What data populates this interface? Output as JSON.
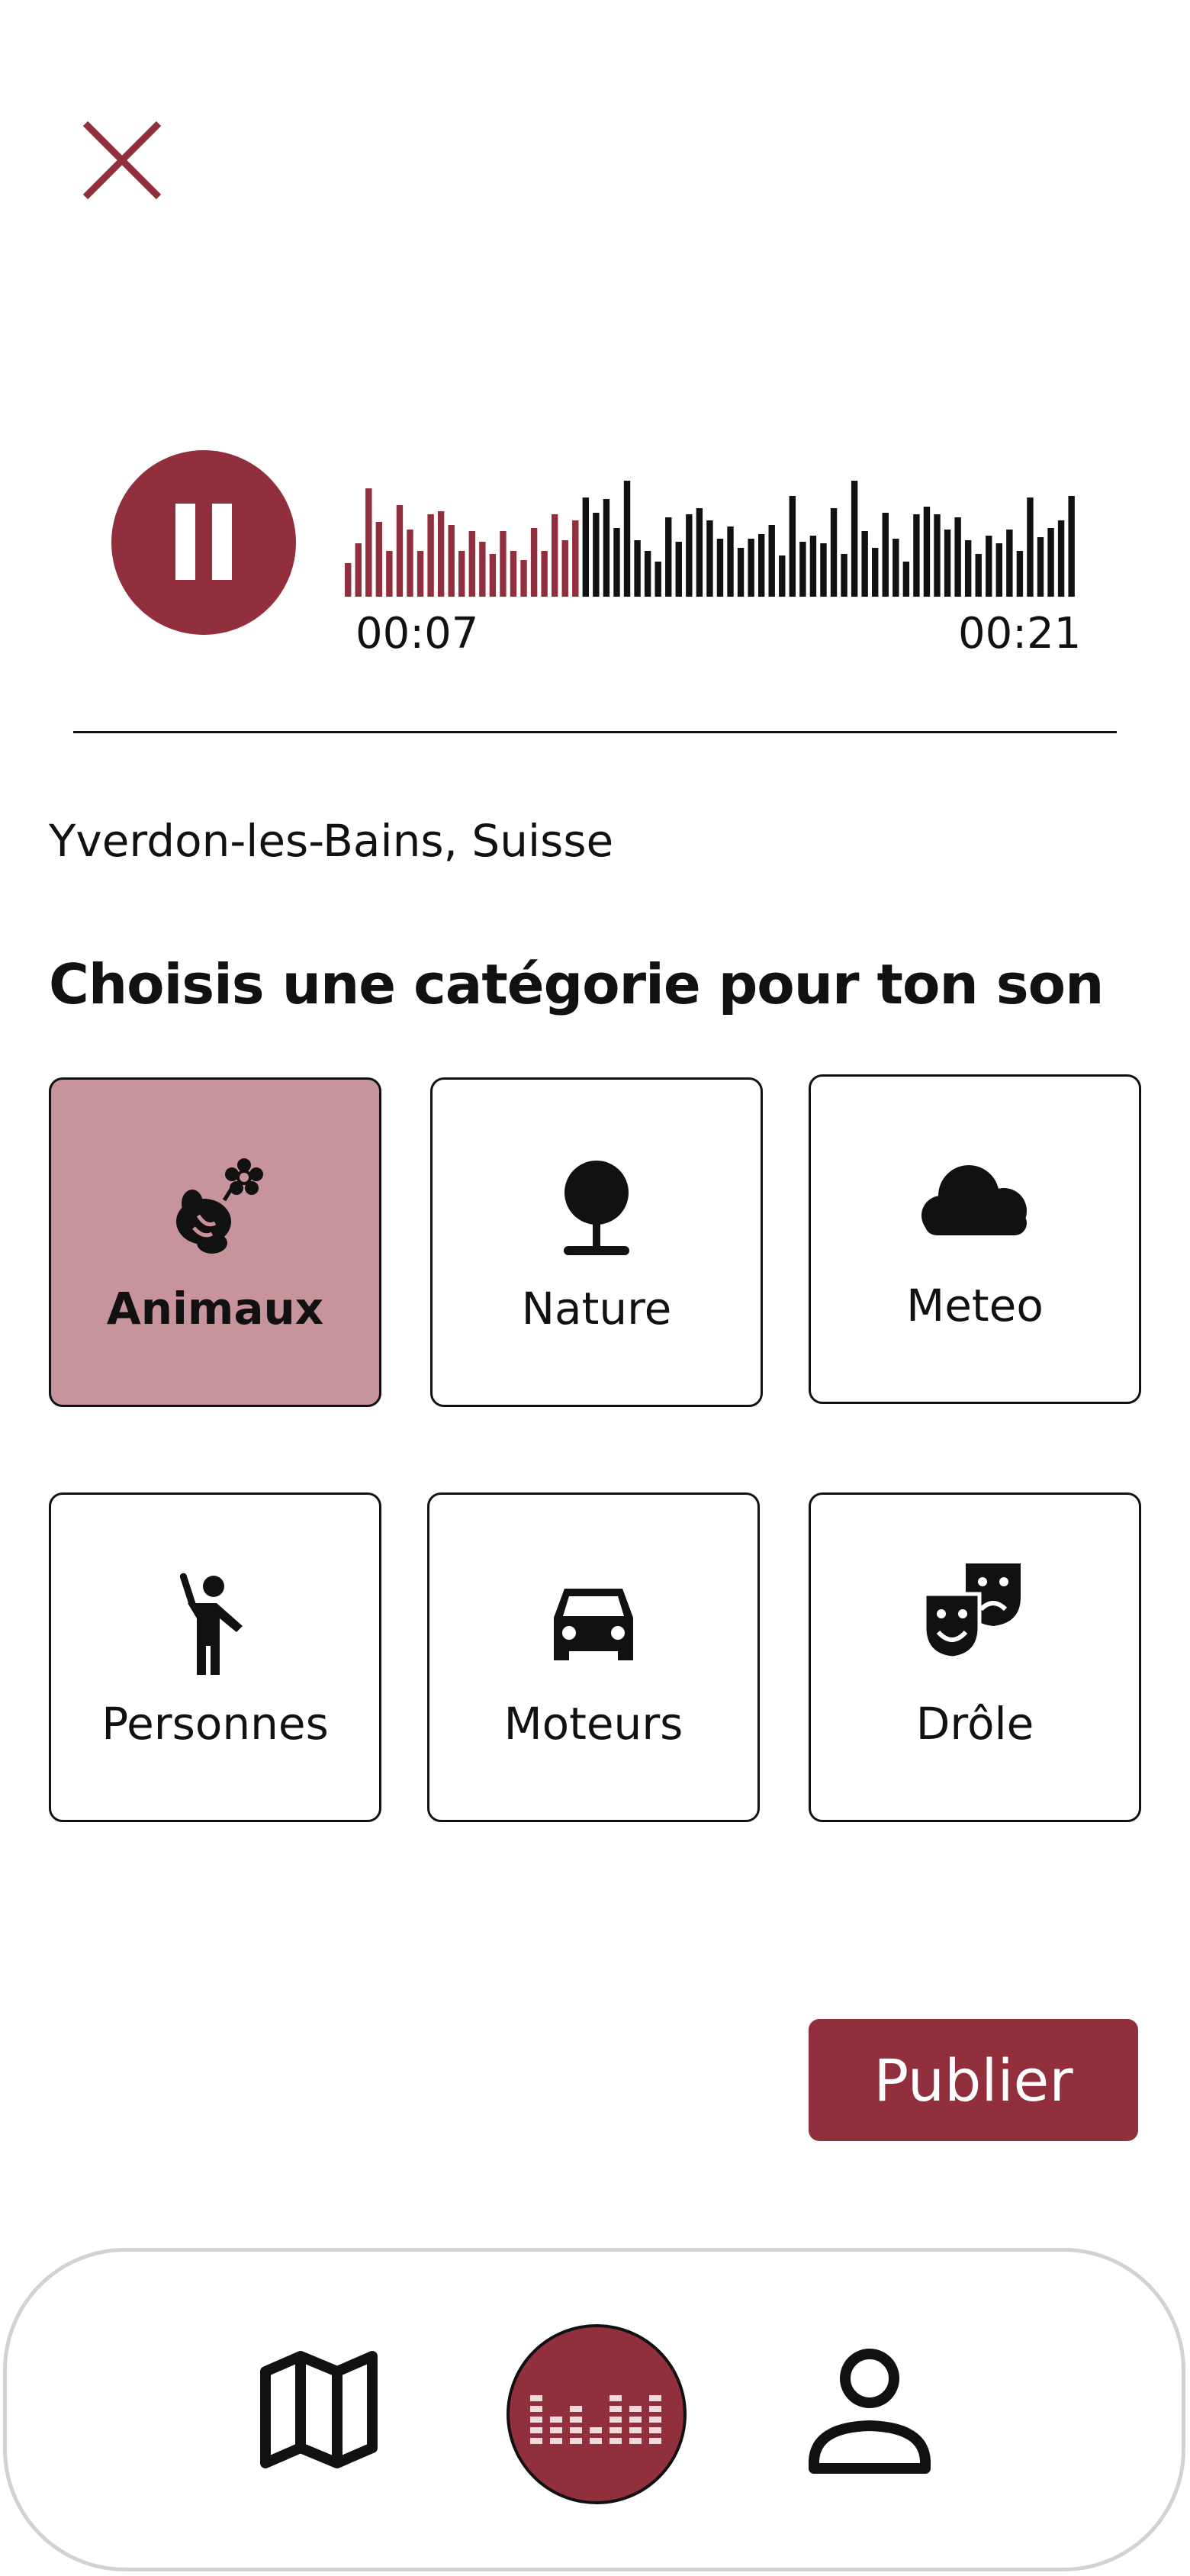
{
  "colors": {
    "accent": "#922f3c",
    "selected_card": "#c8949c",
    "text": "#111111"
  },
  "player": {
    "state_icon": "pause-icon",
    "current_time": "00:07",
    "total_time": "00:21",
    "progress": 0.33
  },
  "location": "Yverdon-les-Bains, Suisse",
  "category_heading": "Choisis une catégorie pour ton son",
  "categories": [
    {
      "label": "Animaux",
      "icon": "bee-flower-icon",
      "selected": true
    },
    {
      "label": "Nature",
      "icon": "tree-icon",
      "selected": false
    },
    {
      "label": "Meteo",
      "icon": "cloud-icon",
      "selected": false
    },
    {
      "label": "Personnes",
      "icon": "person-waving-icon",
      "selected": false
    },
    {
      "label": "Moteurs",
      "icon": "car-icon",
      "selected": false
    },
    {
      "label": "Drôle",
      "icon": "theater-masks-icon",
      "selected": false
    }
  ],
  "publish_label": "Publier",
  "nav": [
    {
      "icon": "map-icon",
      "active": false
    },
    {
      "icon": "equalizer-icon",
      "active": true
    },
    {
      "icon": "profile-icon",
      "active": false
    }
  ]
}
